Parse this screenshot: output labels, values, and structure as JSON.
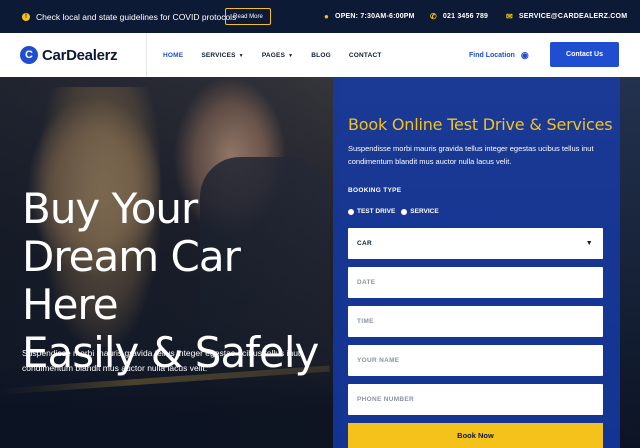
{
  "topbar": {
    "notice": "Check local and state guidelines for COVID protocols",
    "read_more": "Read More",
    "hours": "OPEN: 7:30AM-6:00PM",
    "phone": "021 3456 789",
    "email": "SERVICE@CARDEALERZ.COM"
  },
  "nav": {
    "logo_mark": "C",
    "logo_text": "CarDealerz",
    "items": [
      {
        "label": "HOME",
        "dropdown": false,
        "active": true
      },
      {
        "label": "SERVICES",
        "dropdown": true,
        "active": false
      },
      {
        "label": "PAGES",
        "dropdown": true,
        "active": false
      },
      {
        "label": "BLOG",
        "dropdown": false,
        "active": false
      },
      {
        "label": "CONTACT",
        "dropdown": false,
        "active": false
      }
    ],
    "find_location": "Find Location",
    "contact_button": "Contact Us"
  },
  "hero": {
    "title_line1": "Buy Your",
    "title_line2": "Dream Car Here",
    "title_line3": "Easily & Safely",
    "description": "Suspendisse morbi mauris gravida tellus integer egestas ucibus tellus inut condimentum blandit mus auctor nulla lacus velit."
  },
  "booking": {
    "title": "Book Online Test Drive & Services",
    "description": "Suspendisse morbi mauris gravida tellus integer egestas ucibus tellus inut condimentum blandit mus auctor nulla lacus velit.",
    "type_label": "BOOKING TYPE",
    "options": [
      "TEST DRIVE",
      "SERVICE"
    ],
    "car_select_value": "CAR",
    "date_placeholder": "DATE",
    "time_placeholder": "TIME",
    "name_placeholder": "YOUR NAME",
    "phone_placeholder": "PHONE NUMBER",
    "submit_label": "Book Now"
  },
  "colors": {
    "accent_blue": "#1f4fd0",
    "accent_yellow": "#f5c21c",
    "dark_navy": "#0d1a35"
  }
}
